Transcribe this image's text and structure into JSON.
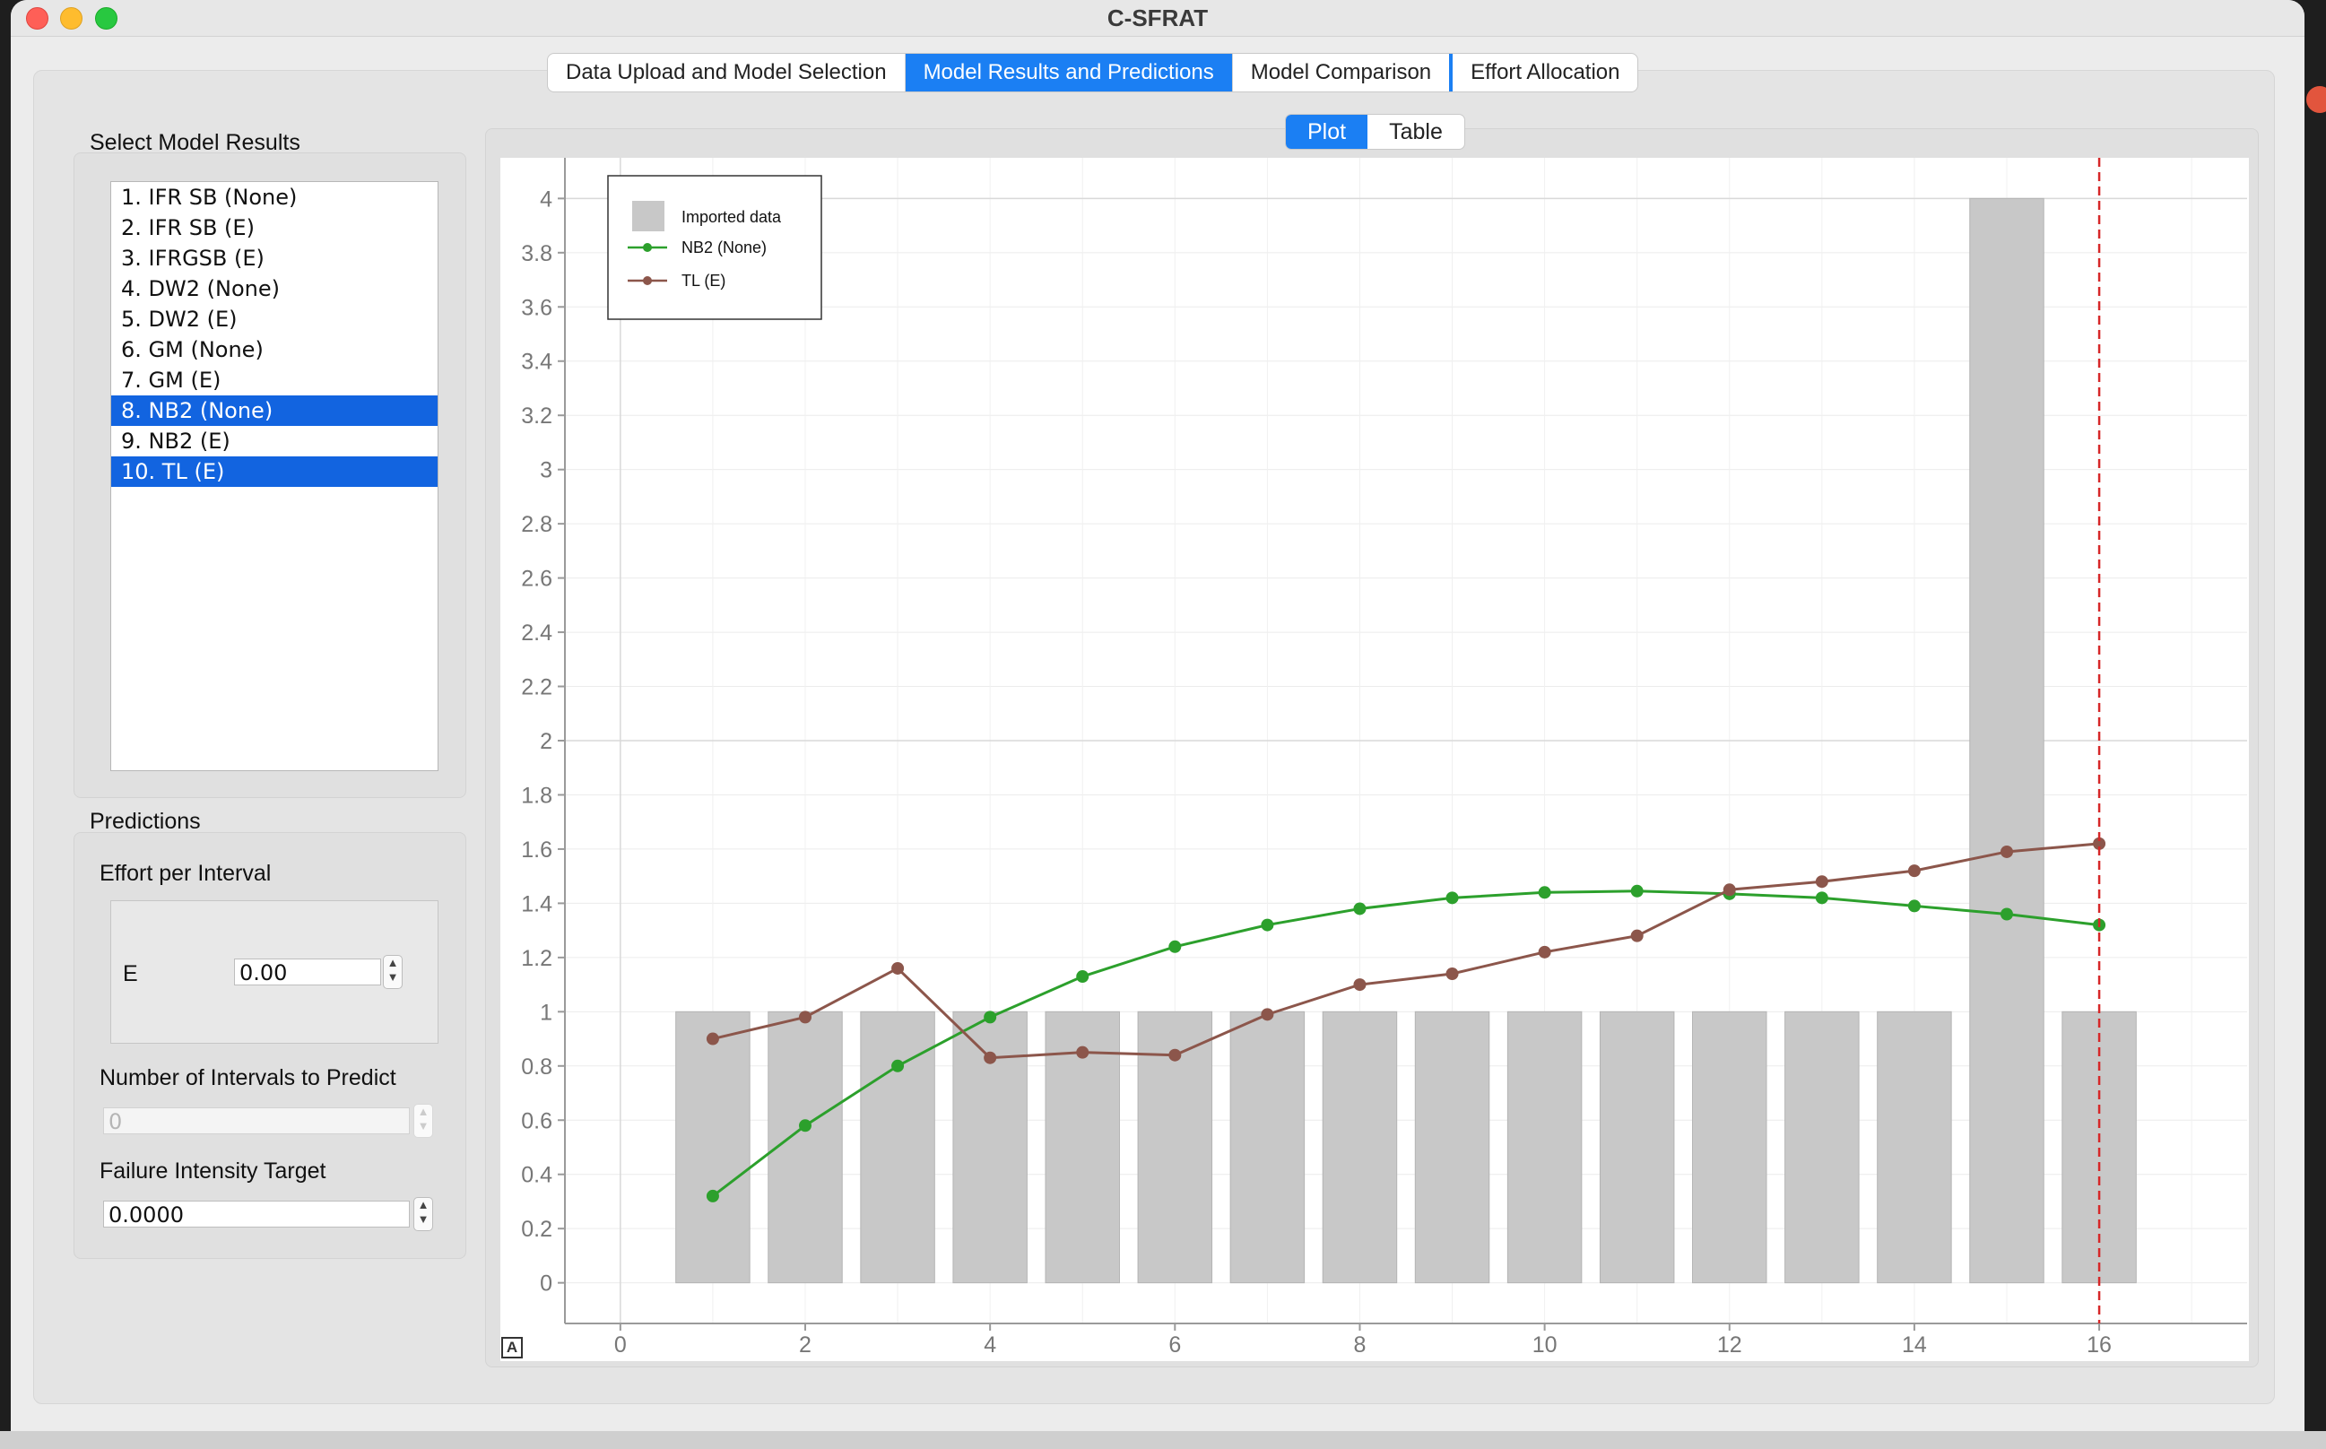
{
  "window": {
    "title": "C-SFRAT"
  },
  "tabs": [
    {
      "label": "Data Upload and Model Selection",
      "active": false
    },
    {
      "label": "Model Results and Predictions",
      "active": true
    },
    {
      "label": "Model Comparison",
      "active": false
    },
    {
      "label": "Effort Allocation",
      "active": false
    }
  ],
  "left": {
    "select_label": "Select Model Results",
    "models": [
      {
        "label": "1. IFR SB (None)",
        "selected": false
      },
      {
        "label": "2. IFR SB (E)",
        "selected": false
      },
      {
        "label": "3. IFRGSB (E)",
        "selected": false
      },
      {
        "label": "4. DW2 (None)",
        "selected": false
      },
      {
        "label": "5. DW2 (E)",
        "selected": false
      },
      {
        "label": "6. GM (None)",
        "selected": false
      },
      {
        "label": "7. GM (E)",
        "selected": false
      },
      {
        "label": "8. NB2 (None)",
        "selected": true
      },
      {
        "label": "9. NB2 (E)",
        "selected": false
      },
      {
        "label": "10. TL (E)",
        "selected": true
      }
    ],
    "predictions": {
      "label": "Predictions",
      "effort_label": "Effort per Interval",
      "effort_var": "E",
      "effort_value": "0.00",
      "intervals_label": "Number of Intervals to Predict",
      "intervals_value": "0",
      "fit_label": "Failure Intensity Target",
      "fit_value": "0.0000"
    }
  },
  "view_toggle": {
    "plot": "Plot",
    "table": "Table",
    "active": "plot"
  },
  "auto_button": "A",
  "chart_data": {
    "type": "bar",
    "xlim": [
      -0.6,
      17.6
    ],
    "ylim": [
      -0.15,
      4.15
    ],
    "x_ticks": [
      0,
      2,
      4,
      6,
      8,
      10,
      12,
      14,
      16
    ],
    "y_ticks": [
      0,
      0.2,
      0.4,
      0.6,
      0.8,
      1,
      1.2,
      1.4,
      1.6,
      1.8,
      2,
      2.2,
      2.4,
      2.6,
      2.8,
      3,
      3.2,
      3.4,
      3.6,
      3.8,
      4
    ],
    "x_tick_labels": [
      "0",
      "2",
      "4",
      "6",
      "8",
      "10",
      "12",
      "14",
      "16"
    ],
    "y_tick_labels": [
      "0",
      "0.2",
      "0.4",
      "0.6",
      "0.8",
      "1",
      "1.2",
      "1.4",
      "1.6",
      "1.8",
      "2",
      "2.2",
      "2.4",
      "2.6",
      "2.8",
      "3",
      "3.2",
      "3.4",
      "3.6",
      "3.8",
      "4"
    ],
    "bars": {
      "name": "Imported data",
      "color": "#c8c8c8",
      "x": [
        1,
        2,
        3,
        4,
        5,
        6,
        7,
        8,
        9,
        10,
        11,
        12,
        13,
        14,
        15,
        16
      ],
      "values": [
        1,
        1,
        1,
        1,
        1,
        1,
        1,
        1,
        1,
        1,
        1,
        1,
        1,
        1,
        4,
        1
      ]
    },
    "series": [
      {
        "name": "NB2 (None)",
        "color": "#2ca02c",
        "x": [
          1,
          2,
          3,
          4,
          5,
          6,
          7,
          8,
          9,
          10,
          11,
          12,
          13,
          14,
          15,
          16
        ],
        "values": [
          0.32,
          0.58,
          0.8,
          0.98,
          1.13,
          1.24,
          1.32,
          1.38,
          1.42,
          1.44,
          1.445,
          1.435,
          1.42,
          1.39,
          1.36,
          1.32
        ]
      },
      {
        "name": "TL (E)",
        "color": "#8c564b",
        "x": [
          1,
          2,
          3,
          4,
          5,
          6,
          7,
          8,
          9,
          10,
          11,
          12,
          13,
          14,
          15,
          16
        ],
        "values": [
          0.9,
          0.98,
          1.16,
          0.83,
          0.85,
          0.84,
          0.99,
          1.1,
          1.14,
          1.22,
          1.28,
          1.45,
          1.48,
          1.52,
          1.59,
          1.62
        ]
      }
    ],
    "vertical_line": {
      "x": 16,
      "color": "#d62728",
      "style": "dashed"
    },
    "grid": true,
    "legend": "top-left"
  }
}
